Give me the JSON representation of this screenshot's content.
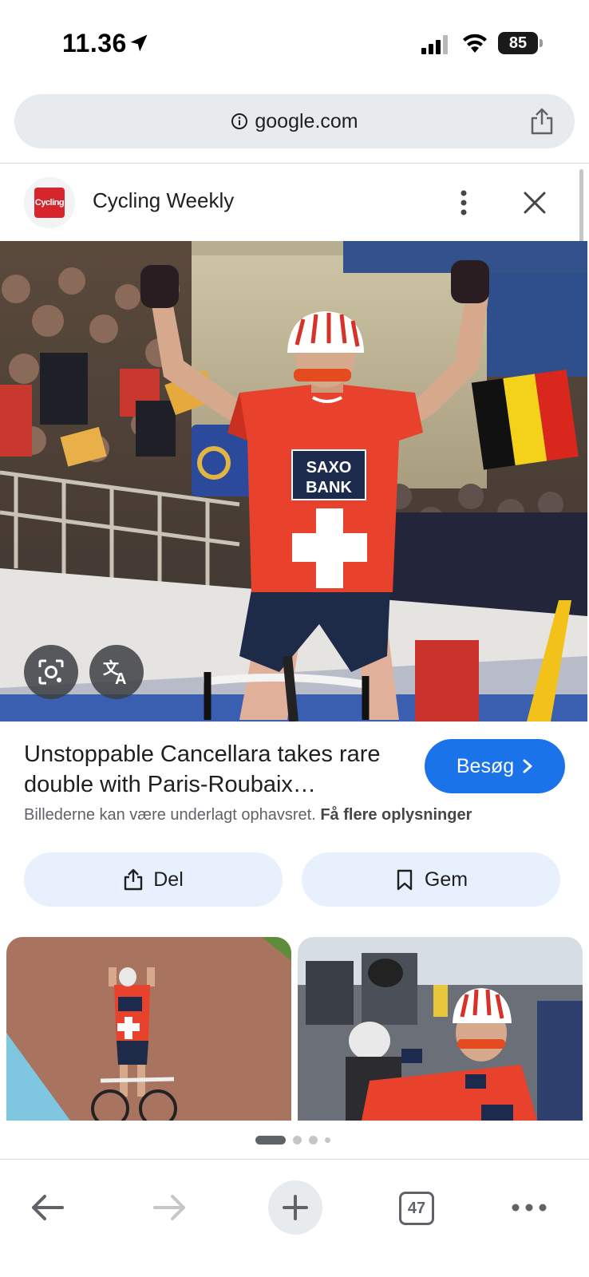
{
  "status_bar": {
    "time": "11.36",
    "battery": "85"
  },
  "url_bar": {
    "url": "google.com"
  },
  "source": {
    "name": "Cycling Weekly",
    "logo_text": "Cycling"
  },
  "image_overlays": {
    "lens_icon": "lens-icon",
    "translate_icon": "translate-icon"
  },
  "article": {
    "title": "Unstoppable Cancellara takes rare double with Paris-Roubaix…",
    "visit_label": "Besøg",
    "copyright_text": "Billederne kan være underlagt ophavsret.",
    "copyright_link": "Få flere oplysninger"
  },
  "actions": {
    "share_label": "Del",
    "save_label": "Gem"
  },
  "image_text": {
    "jersey_line1": "SAXO",
    "jersey_line2": "BANK"
  },
  "pager": {
    "active_index": 0,
    "count": 4
  },
  "toolbar": {
    "tab_count": "47"
  },
  "colors": {
    "accent": "#1a73e8",
    "action_bg": "#e8f0fe",
    "url_bar_bg": "#e8ebee",
    "jersey_red": "#e8412c"
  }
}
